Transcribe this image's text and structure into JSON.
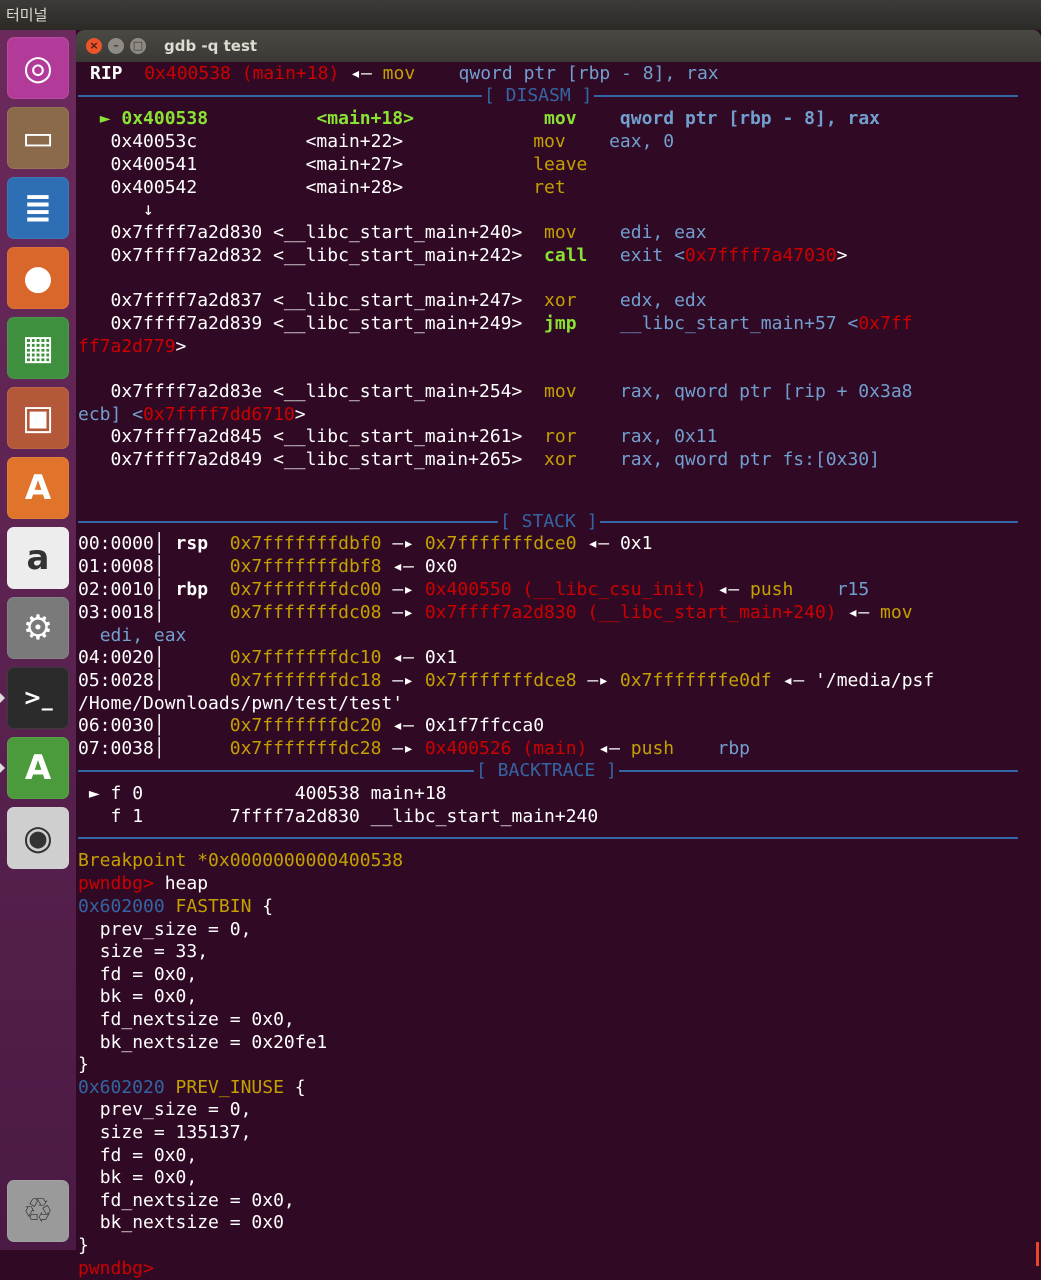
{
  "top_panel": {
    "app_name": "터미널"
  },
  "window": {
    "title": "gdb -q test",
    "close_glyph": "×",
    "min_glyph": "–",
    "max_glyph": "□"
  },
  "launcher": {
    "items": [
      {
        "name": "ubuntu-icon",
        "glyph": "◎",
        "bg": "#b23b9a"
      },
      {
        "name": "files-icon",
        "glyph": "▭",
        "bg": "#8a6a4a"
      },
      {
        "name": "writer-icon",
        "glyph": "≣",
        "bg": "#2d6eb4"
      },
      {
        "name": "firefox-icon",
        "glyph": "●",
        "bg": "#d9662a"
      },
      {
        "name": "calc-icon",
        "glyph": "▦",
        "bg": "#3e8f3e"
      },
      {
        "name": "impress-icon",
        "glyph": "▣",
        "bg": "#b4583a"
      },
      {
        "name": "software-center-icon",
        "glyph": "A",
        "bg": "#e0742a"
      },
      {
        "name": "amazon-icon",
        "glyph": "a",
        "bg": "#ededed"
      },
      {
        "name": "settings-icon",
        "glyph": "⚙",
        "bg": "#7a7a7a"
      },
      {
        "name": "terminal-icon",
        "glyph": ">_",
        "bg": "#2b2b2b"
      },
      {
        "name": "updater-icon",
        "glyph": "A",
        "bg": "#4b9a3b"
      },
      {
        "name": "dvd-icon",
        "glyph": "◉",
        "bg": "#cfcfcf"
      },
      {
        "name": "trash-icon",
        "glyph": "♲",
        "bg": "#9a9a9a"
      }
    ]
  },
  "registers": {
    "label": "RIP",
    "addr": "0x400538",
    "sym": "(main+18)",
    "arrow": "◂—",
    "op": "mov",
    "args": "qword ptr [rbp - 8], rax"
  },
  "sections": {
    "disasm": "[ DISASM ]",
    "stack": "[ STACK ]",
    "backtrace": "[ BACKTRACE ]"
  },
  "disasm": {
    "current_marker": "►",
    "rows": [
      {
        "addr": "0x400538",
        "sym": "<main+18>",
        "op": "mov",
        "args": "qword ptr [rbp - 8], rax"
      },
      {
        "addr": "0x40053c",
        "sym": "<main+22>",
        "op": "mov",
        "args": "eax, 0"
      },
      {
        "addr": "0x400541",
        "sym": "<main+27>",
        "op": "leave",
        "args": ""
      },
      {
        "addr": "0x400542",
        "sym": "<main+28>",
        "op": "ret",
        "args": ""
      },
      {
        "addr": "0x7ffff7a2d830",
        "sym": "<__libc_start_main+240>",
        "op": "mov",
        "args": "edi, eax"
      },
      {
        "addr": "0x7ffff7a2d832",
        "sym": "<__libc_start_main+242>",
        "op": "call",
        "args": "exit <",
        "target": "0x7ffff7a47030",
        "tail": ">"
      },
      {
        "addr": "0x7ffff7a2d837",
        "sym": "<__libc_start_main+247>",
        "op": "xor",
        "args": "edx, edx"
      },
      {
        "addr": "0x7ffff7a2d839",
        "sym": "<__libc_start_main+249>",
        "op": "jmp",
        "args": "__libc_start_main+57 <",
        "target": "0x7ff"
      },
      {
        "addr": "0x7ffff7a2d83e",
        "sym": "<__libc_start_main+254>",
        "op": "mov",
        "args": "rax, qword ptr [rip + 0x3a8"
      },
      {
        "addr": "0x7ffff7a2d845",
        "sym": "<__libc_start_main+261>",
        "op": "ror",
        "args": "rax, 0x11"
      },
      {
        "addr": "0x7ffff7a2d849",
        "sym": "<__libc_start_main+265>",
        "op": "xor",
        "args": "rax, qword ptr fs:[0x30]"
      }
    ],
    "down_arrow": "↓",
    "wrap1_target": "ff7a2d779",
    "wrap1_tail": ">",
    "wrap2_text": "ecb] <",
    "wrap2_target": "0x7ffff7dd6710",
    "wrap2_tail": ">"
  },
  "stack": {
    "rows": [
      {
        "idx": "00:0000",
        "reg": "rsp",
        "addr": "0x7fffffffdbf0",
        "arr1": "—▸",
        "val": "0x7fffffffdce0",
        "arr2": "◂—",
        "tail": "0x1"
      },
      {
        "idx": "01:0008",
        "reg": "",
        "addr": "0x7fffffffdbf8",
        "arr1": "◂—",
        "val": "0x0"
      },
      {
        "idx": "02:0010",
        "reg": "rbp",
        "addr": "0x7fffffffdc00",
        "arr1": "—▸",
        "val": "0x400550 (__libc_csu_init)",
        "arr2": "◂—",
        "op": "push",
        "args": "r15"
      },
      {
        "idx": "03:0018",
        "reg": "",
        "addr": "0x7fffffffdc08",
        "arr1": "—▸",
        "val": "0x7ffff7a2d830 (__libc_start_main+240)",
        "arr2": "◂—",
        "op": "mov"
      },
      {
        "idx": "04:0020",
        "reg": "",
        "addr": "0x7fffffffdc10",
        "arr1": "◂—",
        "val": "0x1"
      },
      {
        "idx": "05:0028",
        "reg": "",
        "addr": "0x7fffffffdc18",
        "arr1": "—▸",
        "val": "0x7fffffffdce8",
        "arr2": "—▸",
        "val2": "0x7fffffffe0df",
        "arr3": "◂—",
        "str": "'/media/psf"
      },
      {
        "idx": "06:0030",
        "reg": "",
        "addr": "0x7fffffffdc20",
        "arr1": "◂—",
        "val": "0x1f7ffcca0"
      },
      {
        "idx": "07:0038",
        "reg": "",
        "addr": "0x7fffffffdc28",
        "arr1": "—▸",
        "val": "0x400526 (main)",
        "arr2": "◂—",
        "op": "push",
        "args": "rbp"
      }
    ],
    "wrap_args": "edi, eax",
    "wrap_path": "/Home/Downloads/pwn/test/test'"
  },
  "backtrace": {
    "frames": [
      {
        "marker": "►",
        "label": "f 0",
        "addr": "400538",
        "sym": "main+18"
      },
      {
        "marker": "",
        "label": "f 1",
        "addr": "7ffff7a2d830",
        "sym": "__libc_start_main+240"
      }
    ]
  },
  "output": {
    "breakpoint": "Breakpoint *0x0000000000400538",
    "prompt": "pwndbg>",
    "command": " heap",
    "chunk1_addr": "0x602000",
    "chunk1_type": "FASTBIN",
    "chunk1_fields": [
      "prev_size = 0,",
      "size = 33,",
      "fd = 0x0,",
      "bk = 0x0,",
      "fd_nextsize = 0x0,",
      "bk_nextsize = 0x20fe1"
    ],
    "chunk2_addr": "0x602020",
    "chunk2_type": "PREV_INUSE",
    "chunk2_fields": [
      "prev_size = 0,",
      "size = 135137,",
      "fd = 0x0,",
      "bk = 0x0,",
      "fd_nextsize = 0x0,",
      "bk_nextsize = 0x0"
    ],
    "open_brace": " {",
    "close_brace": "}",
    "final_prompt": "pwndbg>"
  }
}
